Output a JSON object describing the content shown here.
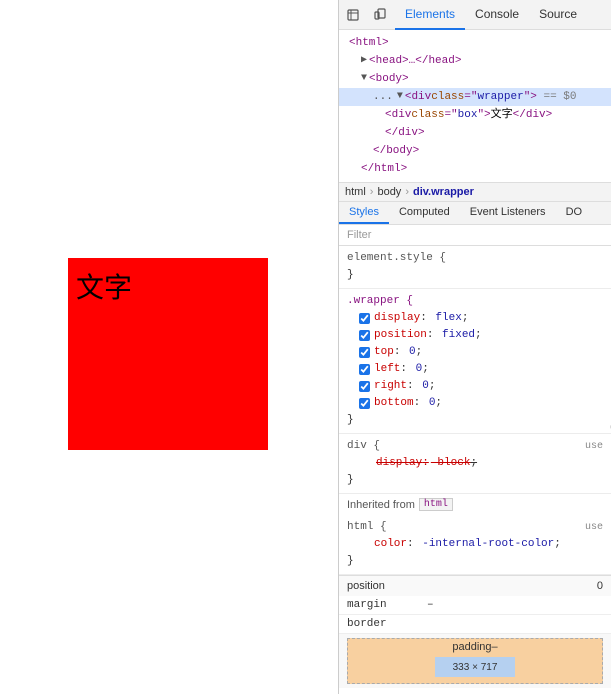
{
  "left_panel": {
    "red_box_text": "文字"
  },
  "devtools": {
    "top_tabs": [
      {
        "label": "⬜",
        "icon": true,
        "name": "cursor-icon"
      },
      {
        "label": "📱",
        "icon": true,
        "name": "device-icon"
      },
      {
        "label": "Elements",
        "active": true
      },
      {
        "label": "Console"
      },
      {
        "label": "Source"
      }
    ],
    "html_tree": {
      "lines": [
        {
          "indent": 1,
          "content": "<html>",
          "type": "tag"
        },
        {
          "indent": 2,
          "content": "▶ <head>…</head>",
          "type": "tag"
        },
        {
          "indent": 2,
          "content": "▼ <body>",
          "type": "tag"
        },
        {
          "indent": 3,
          "content_prefix": "...",
          "content": "▼ <div class=\"wrapper\"> == $0",
          "type": "selected"
        },
        {
          "indent": 4,
          "content": "<div class=\"box\">文字</div>",
          "type": "tag"
        },
        {
          "indent": 4,
          "content": "</div>",
          "type": "tag"
        },
        {
          "indent": 3,
          "content": "</body>",
          "type": "tag"
        },
        {
          "indent": 2,
          "content": "</html>",
          "type": "tag"
        }
      ]
    },
    "breadcrumb": [
      "html",
      "body",
      "div.wrapper"
    ],
    "sub_tabs": [
      "Styles",
      "Computed",
      "Event Listeners",
      "DO"
    ],
    "filter_placeholder": "Filter",
    "css_rules": [
      {
        "selector": "element.style {",
        "properties": [],
        "close": "}"
      },
      {
        "selector": ".wrapper {",
        "properties": [
          {
            "checked": true,
            "prop": "display",
            "value": "flex",
            "strikethrough": false
          },
          {
            "checked": true,
            "prop": "position",
            "value": "fixed",
            "strikethrough": false
          },
          {
            "checked": true,
            "prop": "top",
            "value": "0",
            "strikethrough": false
          },
          {
            "checked": true,
            "prop": "left",
            "value": "0",
            "strikethrough": false
          },
          {
            "checked": true,
            "prop": "right",
            "value": "0",
            "strikethrough": false
          },
          {
            "checked": true,
            "prop": "bottom",
            "value": "0",
            "strikethrough": false
          }
        ],
        "close": "}"
      },
      {
        "selector": "div {",
        "properties": [
          {
            "checked": true,
            "prop": "display",
            "value": "block",
            "strikethrough": true
          }
        ],
        "source": "use",
        "close": "}"
      }
    ],
    "inherited_label": "Inherited from",
    "inherited_tag": "html",
    "html_rule": {
      "selector": "html {",
      "properties": [
        {
          "prop": "color",
          "value": "-internal-root-color"
        }
      ],
      "source": "use",
      "close": "}"
    },
    "box_model": {
      "position_label": "position",
      "position_value": "0",
      "margin_label": "margin",
      "margin_value": "–",
      "border_label": "border",
      "border_value": "",
      "padding_label": "padding–",
      "size_value": "333 × 717"
    }
  }
}
